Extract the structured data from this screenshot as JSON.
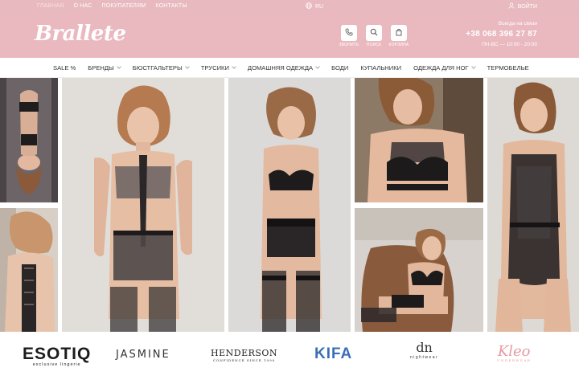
{
  "colors": {
    "accent": "#eab8bf",
    "text": "#333333",
    "kifa": "#3a6fb7",
    "kleo": "#e79aa3"
  },
  "topbar": {
    "nav": [
      "ГЛАВНАЯ",
      "О НАС",
      "ПОКУПАТЕЛЯМ",
      "КОНТАКТЫ"
    ],
    "lang": "RU",
    "login": "ВОЙТИ"
  },
  "header": {
    "logo": "Brallete",
    "actions": [
      {
        "label": "ЗВОНИТЬ",
        "icon": "phone-icon"
      },
      {
        "label": "ПОИСК",
        "icon": "search-icon"
      },
      {
        "label": "КОРЗИНА",
        "icon": "bag-icon"
      }
    ],
    "contact_note": "Всегда на связи",
    "phone": "+38 068 396 27 87",
    "hours": "ПН-ВС — 10:00 - 20:00"
  },
  "menu": [
    {
      "label": "SALE %",
      "dropdown": false
    },
    {
      "label": "БРЕНДЫ",
      "dropdown": true
    },
    {
      "label": "БЮСТГАЛЬТЕРЫ",
      "dropdown": true
    },
    {
      "label": "ТРУСИКИ",
      "dropdown": true
    },
    {
      "label": "ДОМАШНЯЯ ОДЕЖДА",
      "dropdown": true
    },
    {
      "label": "БОДИ",
      "dropdown": false
    },
    {
      "label": "КУПАЛЬНИКИ",
      "dropdown": false
    },
    {
      "label": "ОДЕЖДА ДЛЯ НОГ",
      "dropdown": true
    },
    {
      "label": "ТЕРМОБЕЛЬЕ",
      "dropdown": false
    }
  ],
  "brands": {
    "esotiq": "ESOTIQ",
    "esotiq_sub": "exclusive lingerie",
    "jasmine": "JASMINE",
    "henderson": "HENDERSON",
    "henderson_sub": "CONFIDENCE SINCE 1990",
    "kifa": "KIFA",
    "dn": "dn",
    "dn_sub": "nightwear",
    "kleo": "Kleo",
    "kleo_sub": "UNDERWEAR"
  }
}
